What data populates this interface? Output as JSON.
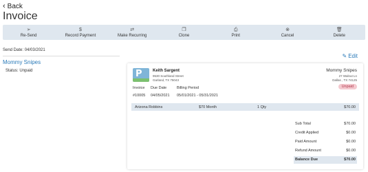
{
  "header": {
    "back_label": "Back",
    "title": "Invoice"
  },
  "toolbar": {
    "items": [
      {
        "label": "Re-Send",
        "icon": "send-icon"
      },
      {
        "label": "Record Payment",
        "icon": "dollar-icon"
      },
      {
        "label": "Make Recurring",
        "icon": "repeat-icon"
      },
      {
        "label": "Clone",
        "icon": "copy-icon"
      },
      {
        "label": "Print",
        "icon": "print-icon"
      },
      {
        "label": "Cancel",
        "icon": "cancel-icon"
      },
      {
        "label": "Delete",
        "icon": "trash-icon"
      }
    ]
  },
  "sidebar": {
    "send_date": "Send Date: 04/03/2021",
    "customer": "Mommy Snipes",
    "status_label": "Status:",
    "status_value": "Unpaid"
  },
  "edit_label": "Edit",
  "invoice": {
    "business": {
      "name": "Keith Sargent",
      "address1": "9530 Southland Street",
      "address2": "Garland, TX 75043"
    },
    "customer": {
      "name": "Mommy Snipes",
      "address1": "27 Walnut Ln",
      "address2": "Dallas , TX 74125"
    },
    "status_badge": "Unpaid",
    "meta_headers": [
      "Invoice",
      "Due Date",
      "Billing Period"
    ],
    "meta_values": [
      "#10005",
      "04/05/2021",
      "05/01/2021 - 05/31/2021"
    ],
    "line_item": {
      "name": "Arizona Robbins",
      "rate": "$70 Month",
      "qty": "1 Qty",
      "amount": "$70.00"
    },
    "totals": [
      {
        "label": "Sub Total",
        "value": "$70.00"
      },
      {
        "label": "Credit Applied",
        "value": "$0.00"
      },
      {
        "label": "Paid Amount",
        "value": "$0.00"
      },
      {
        "label": "Refund Amount",
        "value": "$0.00"
      },
      {
        "label": "Balance Due",
        "value": "$70.00"
      }
    ]
  },
  "colors": {
    "accent": "#2a7ab8",
    "toolbar_bg": "#dfe7ef",
    "unpaid_bg": "#f4c9cf",
    "unpaid_text": "#b0384c"
  }
}
